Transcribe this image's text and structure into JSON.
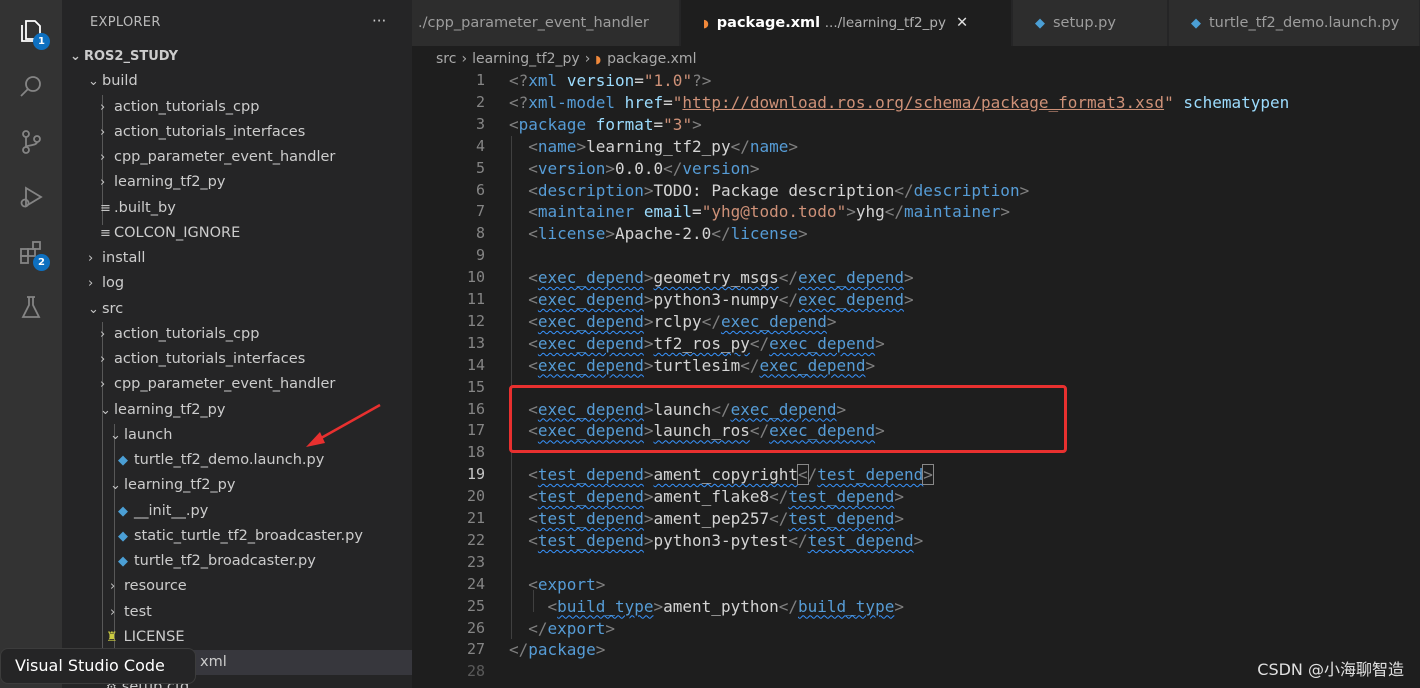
{
  "activity_bar": {
    "explorer_badge": "1",
    "extensions_badge": "2"
  },
  "sidebar": {
    "header": "EXPLORER",
    "more": "···",
    "items": [
      {
        "label": "ROS2_STUDY",
        "chevron": "⌄"
      },
      {
        "label": "build",
        "chevron": "⌄"
      },
      {
        "label": "action_tutorials_cpp",
        "chevron": "›"
      },
      {
        "label": "action_tutorials_interfaces",
        "chevron": "›"
      },
      {
        "label": "cpp_parameter_event_handler",
        "chevron": "›"
      },
      {
        "label": "learning_tf2_py",
        "chevron": "›"
      },
      {
        "label": ".built_by",
        "chevron": "≡"
      },
      {
        "label": "COLCON_IGNORE",
        "chevron": "≡"
      },
      {
        "label": "install",
        "chevron": "›"
      },
      {
        "label": "log",
        "chevron": "›"
      },
      {
        "label": "src",
        "chevron": "⌄"
      },
      {
        "label": "action_tutorials_cpp",
        "chevron": "›"
      },
      {
        "label": "action_tutorials_interfaces",
        "chevron": "›"
      },
      {
        "label": "cpp_parameter_event_handler",
        "chevron": "›"
      },
      {
        "label": "learning_tf2_py",
        "chevron": "⌄"
      },
      {
        "label": "launch",
        "chevron": "⌄"
      },
      {
        "label": "turtle_tf2_demo.launch.py",
        "chevron": ""
      },
      {
        "label": "learning_tf2_py",
        "chevron": "⌄"
      },
      {
        "label": "__init__.py",
        "chevron": ""
      },
      {
        "label": "static_turtle_tf2_broadcaster.py",
        "chevron": ""
      },
      {
        "label": "turtle_tf2_broadcaster.py",
        "chevron": ""
      },
      {
        "label": "resource",
        "chevron": "›"
      },
      {
        "label": "test",
        "chevron": "›"
      },
      {
        "label": "LICENSE",
        "chevron": ""
      },
      {
        "label": "xml",
        "chevron": ""
      },
      {
        "label": "setup.cfg",
        "chevron": ""
      }
    ]
  },
  "tabs": [
    {
      "label": "./cpp_parameter_event_handler"
    },
    {
      "label": "package.xml",
      "path": ".../learning_tf2_py",
      "close": "✕"
    },
    {
      "label": "setup.py"
    },
    {
      "label": "turtle_tf2_demo.launch.py"
    }
  ],
  "breadcrumb": {
    "parts": [
      "src",
      "learning_tf2_py",
      "package.xml"
    ]
  },
  "editor": {
    "current_line": 19,
    "line_numbers": [
      "1",
      "2",
      "3",
      "4",
      "5",
      "6",
      "7",
      "8",
      "9",
      "10",
      "11",
      "12",
      "13",
      "14",
      "15",
      "16",
      "17",
      "18",
      "19",
      "20",
      "21",
      "22",
      "23",
      "24",
      "25",
      "26",
      "27",
      "28"
    ],
    "code": {
      "decl_version": "1.0",
      "model_href": "http://download.ros.org/schema/package_format3.xsd",
      "model_tail": "schematypen",
      "format": "3",
      "name": "learning_tf2_py",
      "version": "0.0.0",
      "description": "TODO: Package description",
      "maintainer_email": "yhg@todo.todo",
      "maintainer": "yhg",
      "license": "Apache-2.0",
      "exec_depends": [
        "geometry_msgs",
        "python3-numpy",
        "rclpy",
        "tf2_ros_py",
        "turtlesim",
        "launch",
        "launch_ros"
      ],
      "test_depends": [
        "ament_copyright",
        "ament_flake8",
        "ament_pep257",
        "python3-pytest"
      ],
      "build_type": "ament_python"
    }
  },
  "tooltip": "Visual Studio Code",
  "watermark": "CSDN @小海聊智造",
  "colors": {
    "accent": "#0e70c0",
    "highlight_box": "#e8302f",
    "arrow": "#e8302f"
  }
}
